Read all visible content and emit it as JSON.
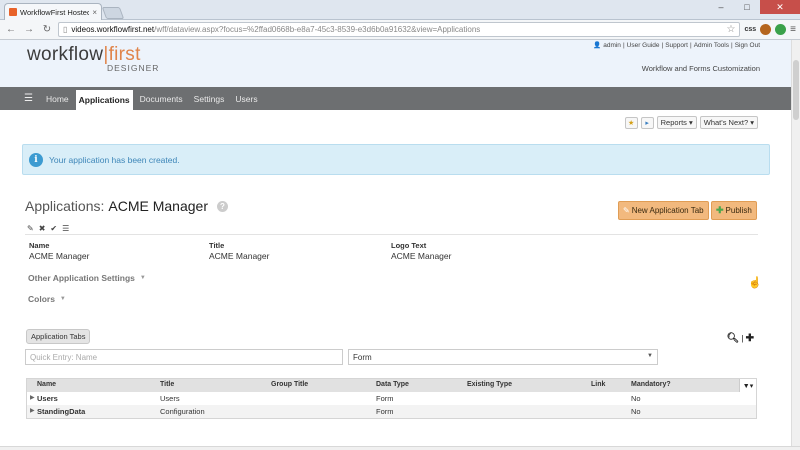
{
  "browser": {
    "tab_title": "WorkflowFirst Hosted De:",
    "url_domain": "videos.workflowfirst.net",
    "url_rest": "/wff/dataview.aspx?focus=%2ffad0668b-e8a7-45c3-8539-e3d6b0a91632&view=Applications",
    "ext_label": "css"
  },
  "header": {
    "logo_left": "workflow",
    "logo_bar": "|",
    "logo_right": "first",
    "logo_sub": "DESIGNER",
    "user": "admin",
    "links": [
      "User Guide",
      "Support",
      "Admin Tools",
      "Sign Out"
    ],
    "tagline": "Workflow and Forms Customization"
  },
  "nav": {
    "items": [
      "Home",
      "Applications",
      "Documents",
      "Settings",
      "Users"
    ],
    "active": "Applications"
  },
  "toolbar_buttons": {
    "reports": "Reports",
    "whats_next": "What's Next?"
  },
  "alert": {
    "message": "Your application has been created."
  },
  "page": {
    "title_prefix": "Applications:",
    "title_name": "ACME Manager",
    "new_tab_button": "New Application Tab",
    "publish_button": "Publish"
  },
  "fields": {
    "name_label": "Name",
    "name_value": "ACME Manager",
    "title_label": "Title",
    "title_value": "ACME Manager",
    "logo_label": "Logo Text",
    "logo_value": "ACME Manager"
  },
  "sections": {
    "other": "Other Application Settings",
    "colors": "Colors"
  },
  "app_tabs": {
    "label": "Application Tabs",
    "quick_placeholder": "Quick Entry: Name",
    "type_value": "Form"
  },
  "table": {
    "headers": [
      "Name",
      "Title",
      "Group Title",
      "Data Type",
      "Existing Type",
      "Link",
      "Mandatory?"
    ],
    "rows": [
      {
        "name": "Users",
        "title": "Users",
        "group_title": "",
        "data_type": "Form",
        "existing_type": "",
        "link": "",
        "mandatory": "No"
      },
      {
        "name": "StandingData",
        "title": "Configuration",
        "group_title": "",
        "data_type": "Form",
        "existing_type": "",
        "link": "",
        "mandatory": "No"
      }
    ]
  },
  "colors": {
    "accent_orange": "#f2b97e",
    "nav_bg": "#6d6f71",
    "alert_bg": "#d9eef8",
    "alert_text": "#3d86b8"
  }
}
